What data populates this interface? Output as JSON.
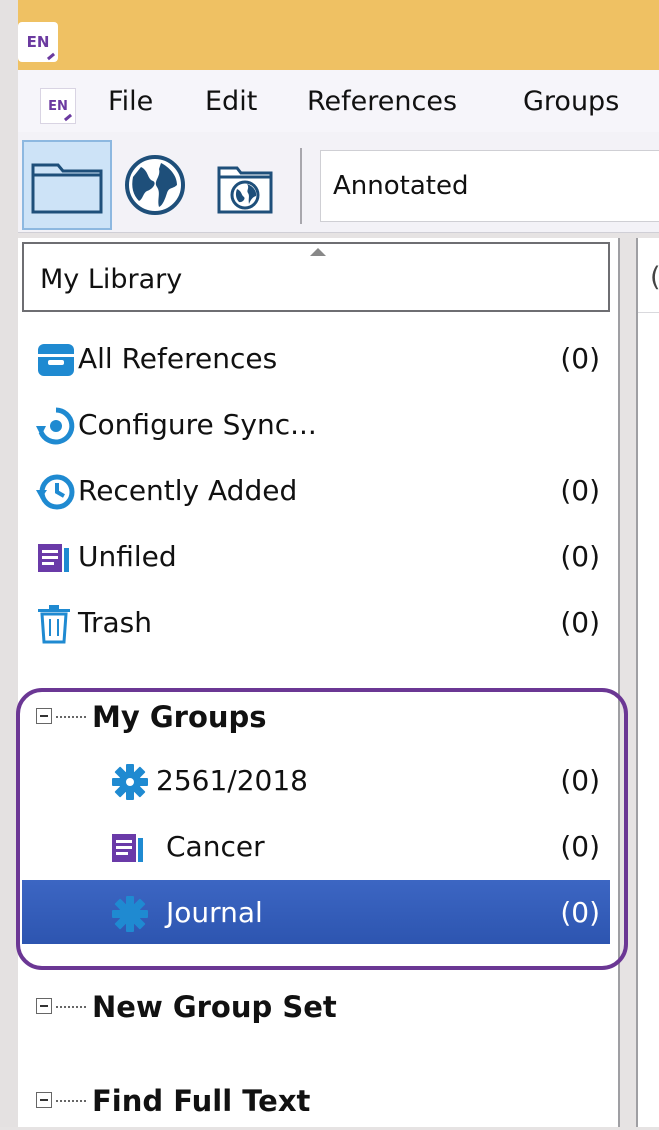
{
  "app": {
    "badge": "EN"
  },
  "menu": [
    "File",
    "Edit",
    "References",
    "Groups"
  ],
  "toolbar": {
    "mode_field": "Annotated"
  },
  "library": {
    "header": "My Library",
    "items": [
      {
        "label": "All References",
        "count": "(0)",
        "icon": "box-icon"
      },
      {
        "label": "Configure Sync...",
        "count": "",
        "icon": "sync-icon"
      },
      {
        "label": "Recently Added",
        "count": "(0)",
        "icon": "clock-icon"
      },
      {
        "label": "Unfiled",
        "count": "(0)",
        "icon": "document-icon"
      },
      {
        "label": "Trash",
        "count": "(0)",
        "icon": "trash-icon"
      }
    ]
  },
  "groups": [
    {
      "label": "My Groups",
      "items": [
        {
          "label": "2561/2018",
          "count": "(0)",
          "icon": "gear-icon"
        },
        {
          "label": "Cancer",
          "count": "(0)",
          "icon": "document-icon"
        },
        {
          "label": "Journal",
          "count": "(0)",
          "icon": "gear-icon",
          "selected": true
        }
      ]
    },
    {
      "label": "New Group Set",
      "items": []
    },
    {
      "label": "Find Full Text",
      "items": []
    }
  ],
  "right_pane": {
    "header_fragment": "("
  },
  "colors": {
    "titlebar": "#efc163",
    "accent": "#3c66c3",
    "highlight": "#6b3794",
    "icon_blue": "#1f8ad1",
    "icon_purple": "#6a3aa8"
  }
}
